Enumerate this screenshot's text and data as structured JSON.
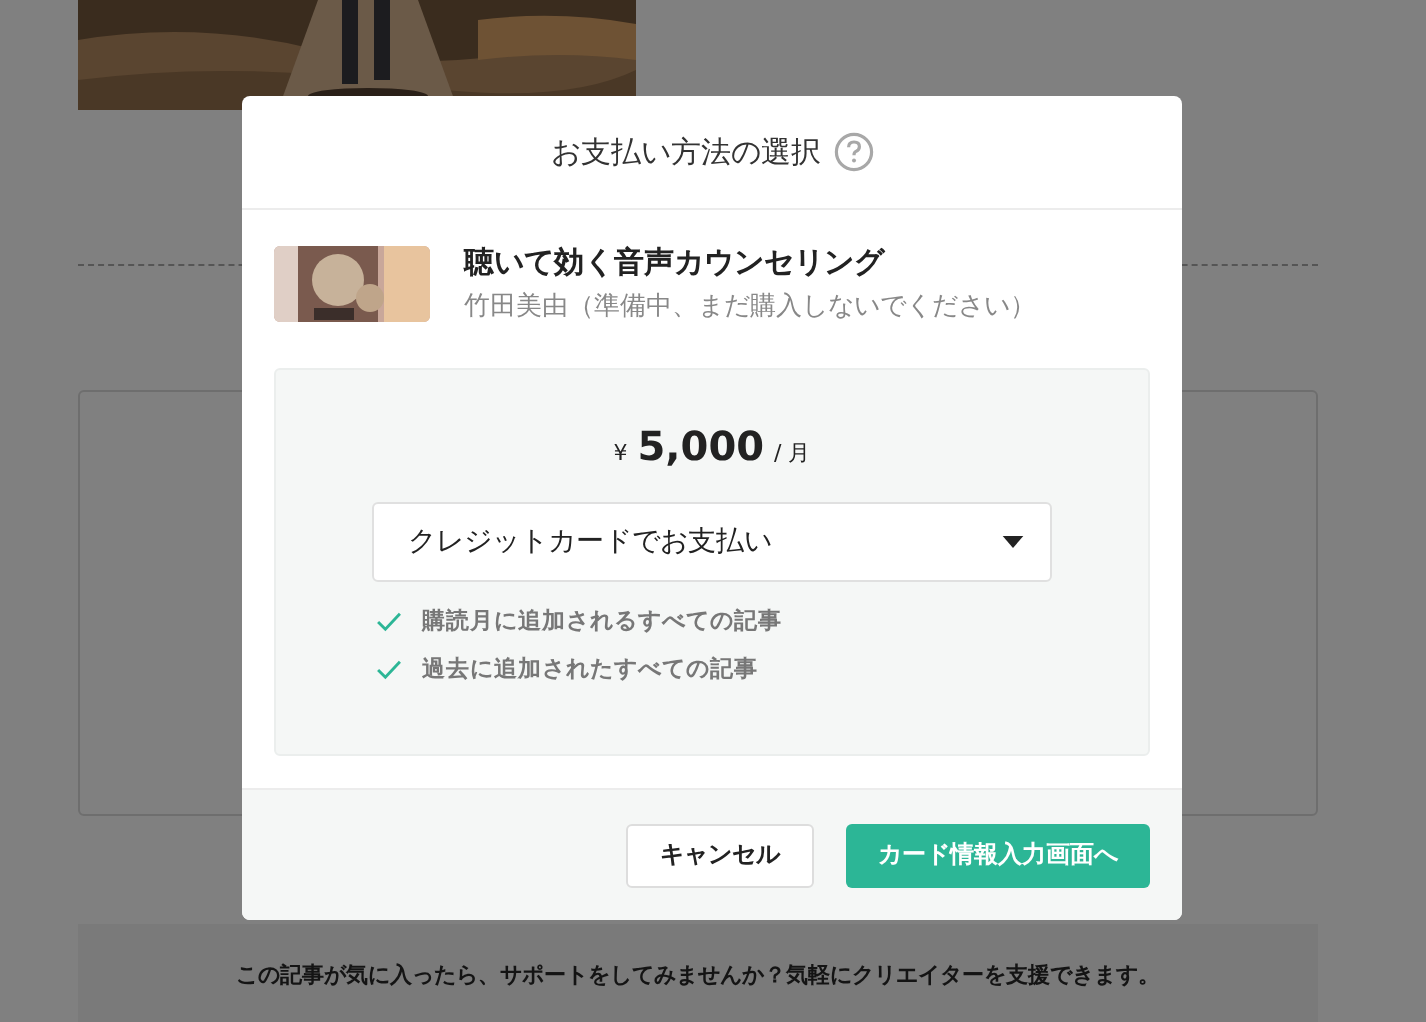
{
  "background": {
    "support_message": "この記事が気に入ったら、サポートをしてみませんか？気軽にクリエイターを支援できます。"
  },
  "dialog": {
    "title": "お支払い方法の選択",
    "product": {
      "title": "聴いて効く音声カウンセリング",
      "author": "竹田美由（準備中、まだ購入しないでください）"
    },
    "price": {
      "currency": "¥",
      "amount": "5,000",
      "unit": "/ 月"
    },
    "payment_method": {
      "value": "クレジットカードでお支払い"
    },
    "features": [
      "購読月に追加されるすべての記事",
      "過去に追加されたすべての記事"
    ],
    "buttons": [
      {
        "label": "キャンセル",
        "kind": "secondary"
      },
      {
        "label": "カード情報入力画面へ",
        "kind": "primary"
      }
    ]
  }
}
